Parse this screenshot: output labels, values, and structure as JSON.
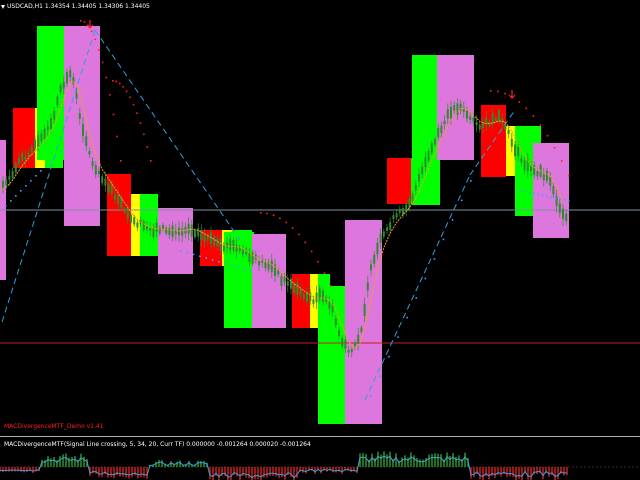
{
  "chart": {
    "symbol_line": "USDCAD,H1  1.34354 1.34405 1.34306 1.34405",
    "indicator_label": "MACDivergenceMTF_Demo v1.41",
    "colors": {
      "background": "#000000",
      "green": "#00ff00",
      "red": "#ff0000",
      "yellow": "#ffff00",
      "violet": "#dd77dd",
      "candle": "#2e8b2e",
      "ma": "#f0a020",
      "blue_line": "#2fa0e0",
      "dots_red": "#ff2020",
      "dots_blue": "#40a0ff",
      "macd_up": "#2ea02e",
      "macd_down": "#e02020"
    }
  },
  "macd": {
    "title": "MACDivergenceMTF(Signal Line crossing, 5, 34, 20, Curr TF) 0.000000 -0.001264 0.000020 -0.001264"
  }
}
